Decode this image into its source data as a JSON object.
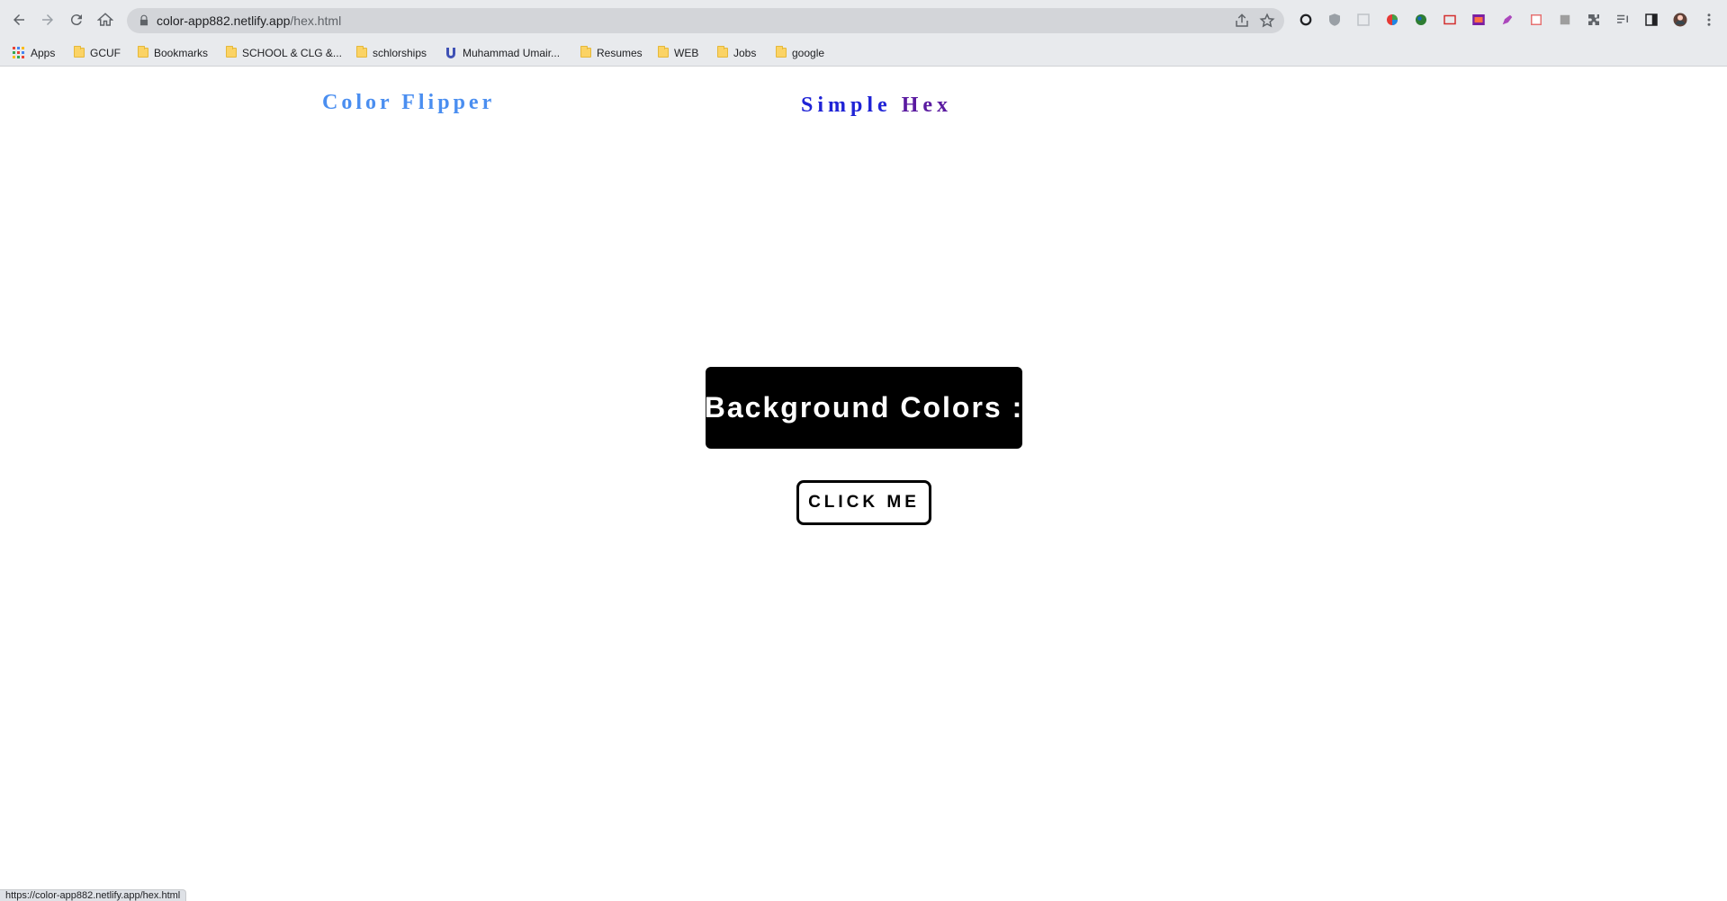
{
  "browser": {
    "url_domain": "color-app882.netlify.app",
    "url_path": "/hex.html",
    "status_url": "https://color-app882.netlify.app/hex.html"
  },
  "bookmarks": [
    {
      "label": "Apps",
      "icon": "apps-grid-icon"
    },
    {
      "label": "GCUF",
      "icon": "folder-icon"
    },
    {
      "label": "Bookmarks",
      "icon": "folder-icon"
    },
    {
      "label": "SCHOOL & CLG &...",
      "icon": "folder-icon"
    },
    {
      "label": "schlorships",
      "icon": "folder-icon"
    },
    {
      "label": "Muhammad Umair...",
      "icon": "u-logo-icon"
    },
    {
      "label": "Resumes",
      "icon": "folder-icon"
    },
    {
      "label": "WEB",
      "icon": "folder-icon"
    },
    {
      "label": "Jobs",
      "icon": "folder-icon"
    },
    {
      "label": "google",
      "icon": "folder-icon"
    }
  ],
  "page": {
    "brand": "Color Flipper",
    "nav_link_main": "Simple ",
    "nav_link_accent": "Hex",
    "bg_label": "Background Colors :",
    "button_label": "CLICK ME"
  },
  "colors": {
    "brand": "#4a8ef0",
    "nav_link": "#1f23d6",
    "nav_link_accent": "#5a1aa0",
    "box_bg": "#000000",
    "page_bg": "#ffffff"
  }
}
